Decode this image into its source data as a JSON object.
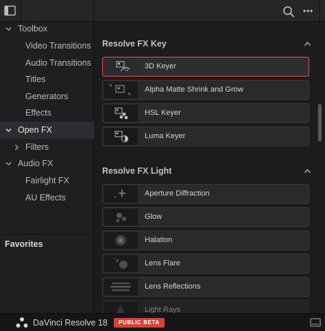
{
  "icons": {
    "panel_toggle": "sidebar-panel-icon",
    "search": "search-icon",
    "more": "more-options-icon",
    "expanded": "chevron-down-icon",
    "collapsed": "chevron-right-icon",
    "section_collapse": "chevron-up-icon",
    "logo": "davinci-resolve-logo",
    "monitor": "workspace-icon"
  },
  "colors": {
    "accent": "#e0554a",
    "badge": "#d0453b",
    "selected_row": "#2d2d31"
  },
  "sidebar": {
    "items": [
      {
        "label": "Toolbox",
        "expanded": true
      },
      {
        "label": "Video Transitions"
      },
      {
        "label": "Audio Transitions"
      },
      {
        "label": "Titles"
      },
      {
        "label": "Generators"
      },
      {
        "label": "Effects"
      },
      {
        "label": "Open FX",
        "expanded": true,
        "selected": true
      },
      {
        "label": "Filters",
        "expanded": false
      },
      {
        "label": "Audio FX",
        "expanded": true
      },
      {
        "label": "Fairlight FX"
      },
      {
        "label": "AU Effects"
      }
    ],
    "favorites": "Favorites"
  },
  "sections": [
    {
      "title": "Resolve FX Key",
      "items": [
        {
          "label": "3D Keyer",
          "selected": true
        },
        {
          "label": "Alpha Matte Shrink and Grow"
        },
        {
          "label": "HSL Keyer"
        },
        {
          "label": "Luma Keyer"
        }
      ]
    },
    {
      "title": "Resolve FX Light",
      "items": [
        {
          "label": "Aperture Diffraction"
        },
        {
          "label": "Glow"
        },
        {
          "label": "Halation"
        },
        {
          "label": "Lens Flare"
        },
        {
          "label": "Lens Reflections"
        },
        {
          "label": "Light Rays"
        }
      ]
    }
  ],
  "footer": {
    "app_name": "DaVinci Resolve 18",
    "badge": "PUBLIC BETA"
  }
}
